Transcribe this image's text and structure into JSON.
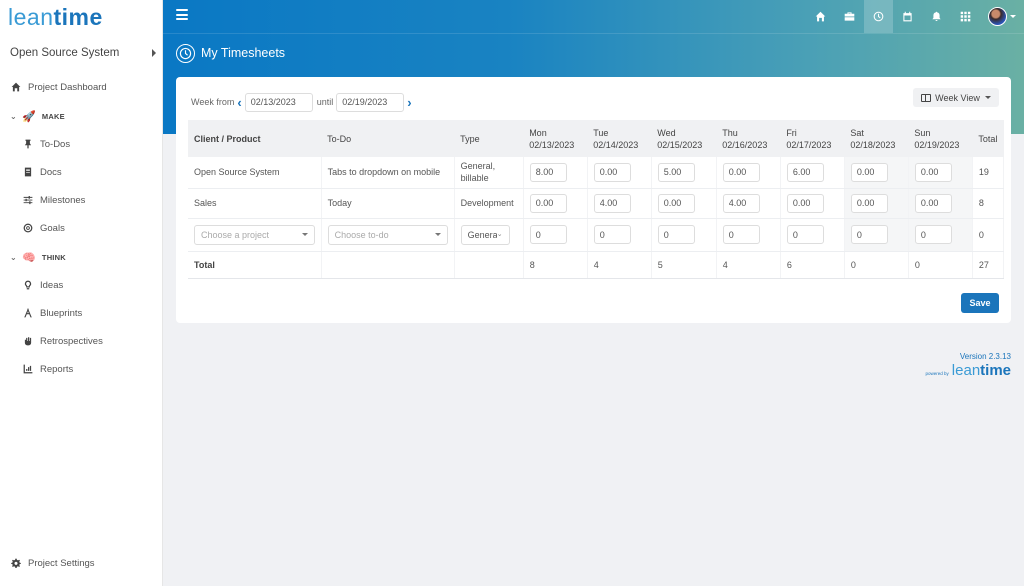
{
  "app": {
    "logo_light": "lean",
    "logo_bold": "time",
    "brand_color": "#1b75bb"
  },
  "sidebar": {
    "project_name": "Open Source System",
    "dashboard": "Project Dashboard",
    "sections": [
      {
        "label": "MAKE",
        "emoji": "🚀",
        "items": [
          {
            "label": "To-Dos",
            "icon": "pin-icon"
          },
          {
            "label": "Docs",
            "icon": "book-icon"
          },
          {
            "label": "Milestones",
            "icon": "sliders-icon"
          },
          {
            "label": "Goals",
            "icon": "target-icon"
          }
        ]
      },
      {
        "label": "THINK",
        "emoji": "🧠",
        "items": [
          {
            "label": "Ideas",
            "icon": "lightbulb-icon"
          },
          {
            "label": "Blueprints",
            "icon": "compass-icon"
          },
          {
            "label": "Retrospectives",
            "icon": "hand-icon"
          },
          {
            "label": "Reports",
            "icon": "chart-icon"
          }
        ]
      }
    ],
    "settings": "Project Settings"
  },
  "topnav": {
    "icons": [
      "home-icon",
      "briefcase-icon",
      "clock-icon",
      "calendar-icon",
      "bell-icon",
      "apps-grid-icon"
    ],
    "active": "clock-icon"
  },
  "page": {
    "title": "My Timesheets"
  },
  "timesheet": {
    "week_from_label": "Week from",
    "until_label": "until",
    "from_date": "02/13/2023",
    "until_date": "02/19/2023",
    "view_button": "Week View",
    "headers": {
      "client": "Client / Product",
      "todo": "To-Do",
      "type": "Type",
      "total": "Total"
    },
    "days": [
      {
        "day": "Mon",
        "date": "02/13/2023"
      },
      {
        "day": "Tue",
        "date": "02/14/2023"
      },
      {
        "day": "Wed",
        "date": "02/15/2023"
      },
      {
        "day": "Thu",
        "date": "02/16/2023"
      },
      {
        "day": "Fri",
        "date": "02/17/2023"
      },
      {
        "day": "Sat",
        "date": "02/18/2023"
      },
      {
        "day": "Sun",
        "date": "02/19/2023"
      }
    ],
    "rows": [
      {
        "client": "Open Source System",
        "todo": "Tabs to dropdown on mobile",
        "type": "General, billable",
        "hours": [
          "8.00",
          "0.00",
          "5.00",
          "0.00",
          "6.00",
          "0.00",
          "0.00"
        ],
        "total": "19"
      },
      {
        "client": "Sales",
        "todo": "Today",
        "type": "Development",
        "hours": [
          "0.00",
          "4.00",
          "0.00",
          "4.00",
          "0.00",
          "0.00",
          "0.00"
        ],
        "total": "8"
      }
    ],
    "new_row": {
      "project_placeholder": "Choose a project",
      "todo_placeholder": "Choose to-do",
      "type_value": "General",
      "hours": [
        "0",
        "0",
        "0",
        "0",
        "0",
        "0",
        "0"
      ],
      "total": "0"
    },
    "totals": {
      "label": "Total",
      "days": [
        "8",
        "4",
        "5",
        "4",
        "6",
        "0",
        "0"
      ],
      "grand": "27"
    },
    "save_label": "Save"
  },
  "footer": {
    "version": "Version 2.3.13",
    "powered_by": "powered by"
  }
}
